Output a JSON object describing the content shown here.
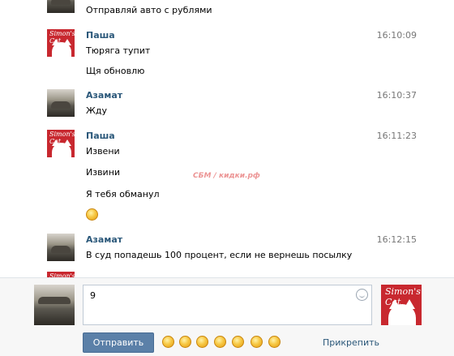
{
  "messages": [
    {
      "author": "",
      "time": "",
      "avatar": "car",
      "lines": [
        "Отправляй авто с рублями"
      ]
    },
    {
      "author": "Паша",
      "time": "16:10:09",
      "avatar": "cat",
      "lines": [
        "Тюряга тупит",
        "Щя обновлю"
      ]
    },
    {
      "author": "Азамат",
      "time": "16:10:37",
      "avatar": "car",
      "lines": [
        "Жду"
      ]
    },
    {
      "author": "Паша",
      "time": "16:11:23",
      "avatar": "cat",
      "lines": [
        "Извени",
        "Извини",
        "Я тебя обманул"
      ],
      "emoji": "cry-emoji"
    },
    {
      "author": "Азамат",
      "time": "16:12:15",
      "avatar": "car",
      "lines": [
        "В суд попадешь 100 процент, если не вернешь посылку"
      ]
    },
    {
      "author": "",
      "time": "",
      "avatar": "cat",
      "lines": []
    }
  ],
  "watermark": "СБМ / кидки.рф",
  "composer": {
    "input_value": "9",
    "send_label": "Отправить",
    "attach_label": "Прикрепить",
    "emoji_bar": [
      "tired-emoji",
      "grimace-emoji",
      "angry-emoji",
      "blush-emoji",
      "glasses-emoji",
      "kiss-emoji",
      "smile-emoji"
    ]
  },
  "avatar_text": "Simon's Cat",
  "colors": {
    "link": "#2b587a",
    "button": "#5b80a8",
    "cat_red": "#c8282f"
  }
}
